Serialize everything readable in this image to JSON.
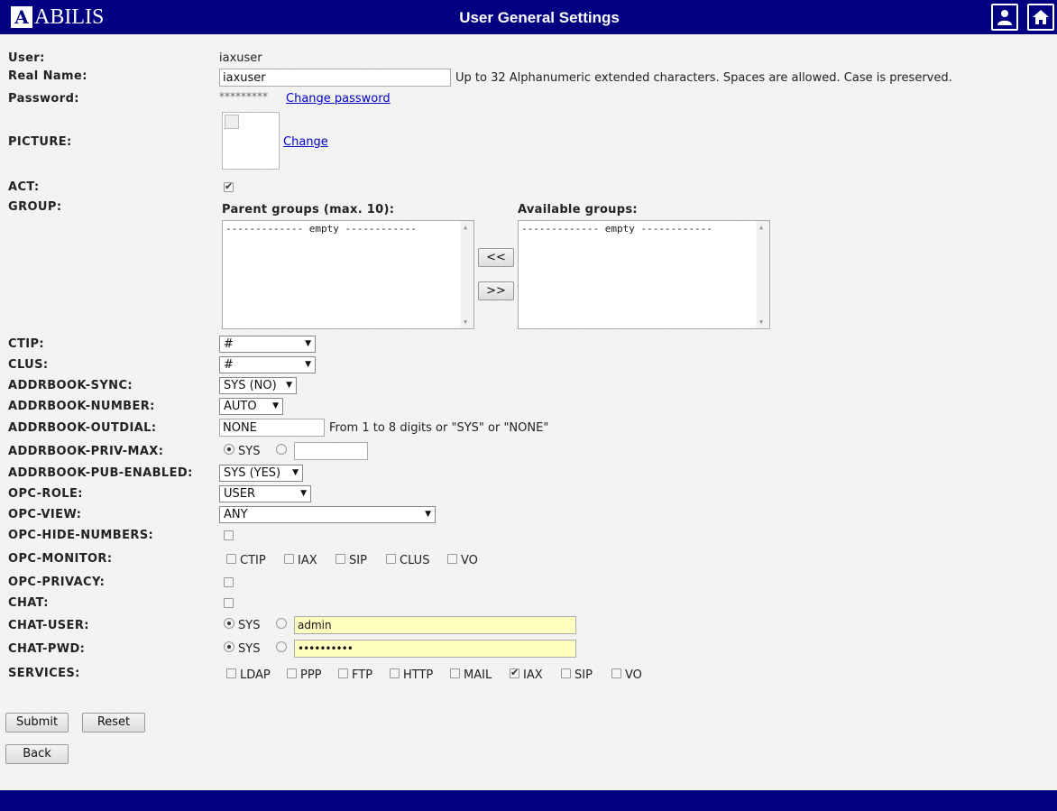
{
  "header": {
    "logo_letter": "A",
    "logo_text": "ABILIS",
    "title": "User General Settings",
    "user_icon": "user-icon",
    "home_icon": "home-icon"
  },
  "fields": {
    "user": {
      "label": "User:",
      "value": "iaxuser"
    },
    "real_name": {
      "label": "Real Name:",
      "value": "iaxuser",
      "hint": "Up to 32 Alphanumeric extended characters. Spaces are allowed. Case is preserved."
    },
    "password": {
      "label": "Password:",
      "value": "*********",
      "link": "Change password"
    },
    "picture": {
      "label": "PICTURE:",
      "link": "Change"
    },
    "act": {
      "label": "ACT:",
      "checked": true
    },
    "group": {
      "label": "GROUP:",
      "parent_title": "Parent groups (max. 10):",
      "available_title": "Available groups:",
      "parent_items": [
        "------------- empty ------------"
      ],
      "available_items": [
        "------------- empty ------------"
      ],
      "add_btn": "<<",
      "remove_btn": ">>"
    },
    "ctip": {
      "label": "CTIP:",
      "value": "#"
    },
    "clus": {
      "label": "CLUS:",
      "value": "#"
    },
    "addrbook_sync": {
      "label": "ADDRBOOK-SYNC:",
      "value": "SYS (NO)"
    },
    "addrbook_number": {
      "label": "ADDRBOOK-NUMBER:",
      "value": "AUTO"
    },
    "addrbook_outdial": {
      "label": "ADDRBOOK-OUTDIAL:",
      "value": "NONE",
      "hint": "From 1 to 8 digits or \"SYS\" or \"NONE\""
    },
    "addrbook_priv_max": {
      "label": "ADDRBOOK-PRIV-MAX:",
      "sys_label": "SYS",
      "value": ""
    },
    "addrbook_pub_enabled": {
      "label": "ADDRBOOK-PUB-ENABLED:",
      "value": "SYS (YES)"
    },
    "opc_role": {
      "label": "OPC-ROLE:",
      "value": "USER"
    },
    "opc_view": {
      "label": "OPC-VIEW:",
      "value": "ANY"
    },
    "opc_hide_numbers": {
      "label": "OPC-HIDE-NUMBERS:",
      "checked": false
    },
    "opc_monitor": {
      "label": "OPC-MONITOR:",
      "options": [
        "CTIP",
        "IAX",
        "SIP",
        "CLUS",
        "VO"
      ]
    },
    "opc_privacy": {
      "label": "OPC-PRIVACY:",
      "checked": false
    },
    "chat": {
      "label": "CHAT:",
      "checked": false
    },
    "chat_user": {
      "label": "CHAT-USER:",
      "sys_label": "SYS",
      "value": "admin"
    },
    "chat_pwd": {
      "label": "CHAT-PWD:",
      "sys_label": "SYS",
      "value": "••••••••••"
    },
    "services": {
      "label": "SERVICES:",
      "options": [
        "LDAP",
        "PPP",
        "FTP",
        "HTTP",
        "MAIL",
        "IAX",
        "SIP",
        "VO"
      ],
      "checked": [
        "IAX"
      ]
    }
  },
  "buttons": {
    "submit": "Submit",
    "reset": "Reset",
    "back": "Back"
  },
  "colors": {
    "bar": "#000080",
    "field_highlight": "#ffffc0"
  }
}
